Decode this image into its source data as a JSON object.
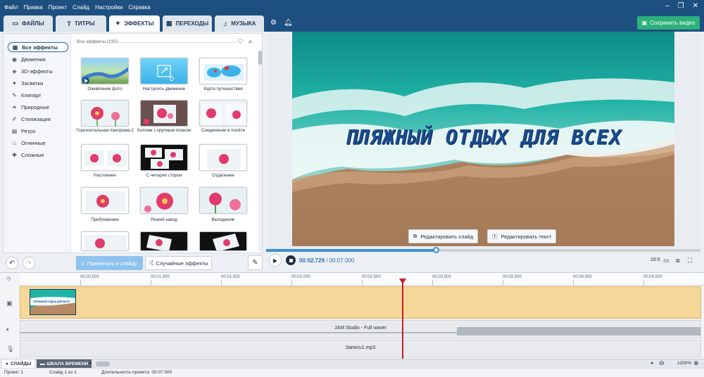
{
  "menu": [
    "Файл",
    "Правка",
    "Проект",
    "Слайд",
    "Настройки",
    "Справка"
  ],
  "tabs": [
    {
      "label": "ФАЙЛЫ",
      "icon": "folder-icon"
    },
    {
      "label": "ТИТРЫ",
      "icon": "text-icon"
    },
    {
      "label": "ЭФФЕКТЫ",
      "icon": "effects-icon",
      "active": true
    },
    {
      "label": "ПЕРЕХОДЫ",
      "icon": "transitions-icon"
    },
    {
      "label": "МУЗЫКА",
      "icon": "music-icon"
    }
  ],
  "save_button": "Сохранить видео",
  "categories": [
    {
      "label": "Все эффекты",
      "active": true
    },
    {
      "label": "Движения"
    },
    {
      "label": "3D-эффекты"
    },
    {
      "label": "Засветки"
    },
    {
      "label": "Клипарт"
    },
    {
      "label": "Природные"
    },
    {
      "label": "Стилизация"
    },
    {
      "label": "Ретро"
    },
    {
      "label": "Огненные"
    },
    {
      "label": "Сложные"
    }
  ],
  "effects_header": "Все эффекты (235)",
  "effects": [
    "Оживление фото",
    "Настроить движение",
    "Карта путешествия",
    "Горизонтальная панорама-2",
    "Коллаж с крупным планом",
    "Соединение в полёте",
    "Наслоение",
    "С четырёх сторон",
    "Отдаление",
    "Приближение",
    "Резкий наезд",
    "Выпадение"
  ],
  "apply_button": "Применить к слайду",
  "random_button": "Случайные эффекты",
  "preview": {
    "title": "ПЛЯЖНЫЙ ОТДЫХ ДЛЯ ВСЕХ",
    "edit_slide": "Редактировать слайд",
    "edit_text": "Редактировать текст"
  },
  "player": {
    "current": "00:02.729",
    "total": "/ 00:07.000",
    "progress": 0.39,
    "aspect": "16:9"
  },
  "ruler": [
    "00:00.500",
    "00:01.000",
    "00:01.500",
    "00:02.000",
    "00:02.500",
    "00:03.000",
    "00:03.500",
    "00:04.000",
    "00:04.500"
  ],
  "tracks": {
    "audio": "JAM Studio - Full waver",
    "voice": "Запись1.mp3",
    "clip_caption": "ПЛЯЖНЫЙ ОТДЫХ ДЛЯ ВСЕХ"
  },
  "bottom_tabs": {
    "slides": "СЛАЙДЫ",
    "timeline": "ШКАЛА ВРЕМЕНИ"
  },
  "zoom": "1200%",
  "status": {
    "project": "Проект 1",
    "slide": "Слайд 1 из 1",
    "duration": "Длительность проекта: 00:07.000"
  }
}
